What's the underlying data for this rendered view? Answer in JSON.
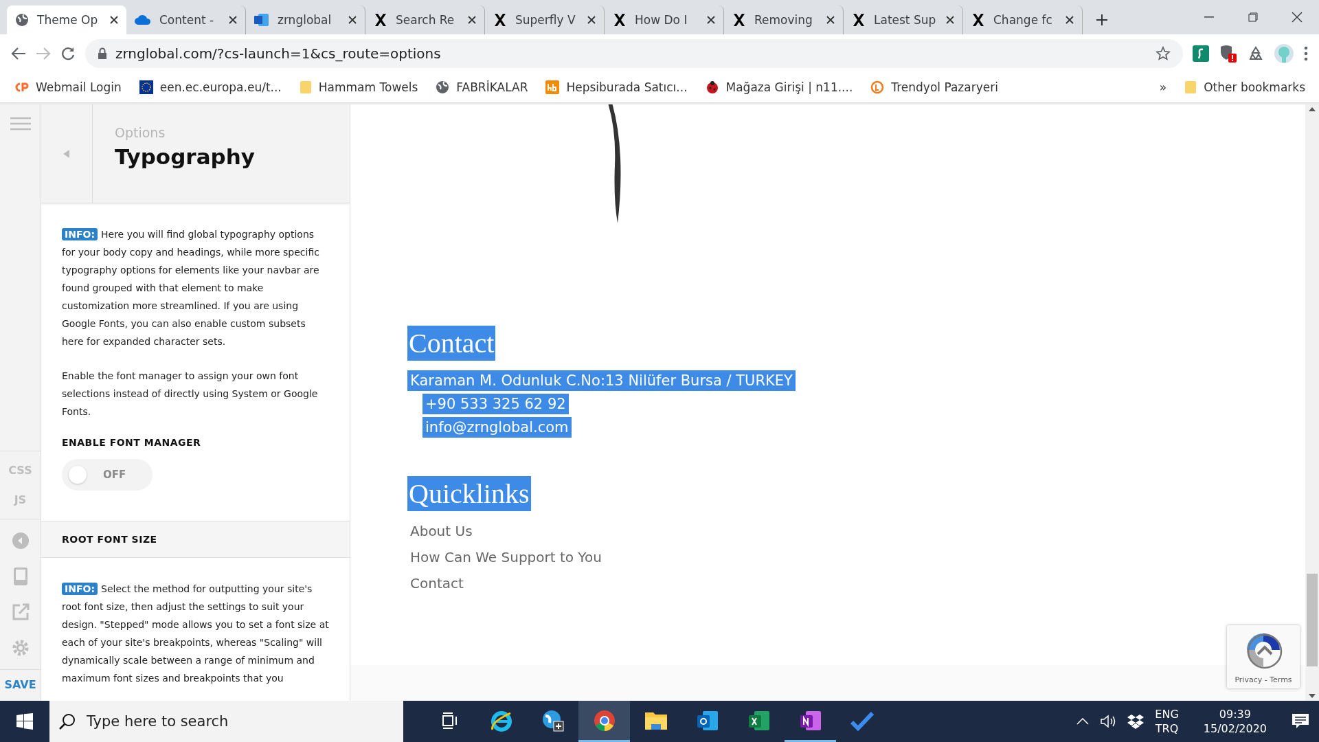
{
  "browser": {
    "tabs": [
      {
        "kind": "globe",
        "title": "Theme Op",
        "selected": true
      },
      {
        "kind": "cloud",
        "title": "Content -",
        "selected": false
      },
      {
        "kind": "doc",
        "title": "zrnglobal",
        "selected": false
      },
      {
        "kind": "x",
        "title": "Search Re",
        "selected": false
      },
      {
        "kind": "x",
        "title": "Superfly V",
        "selected": false
      },
      {
        "kind": "x",
        "title": "How Do I",
        "selected": false
      },
      {
        "kind": "x",
        "title": "Removing",
        "selected": false
      },
      {
        "kind": "x",
        "title": "Latest Sup",
        "selected": false
      },
      {
        "kind": "x",
        "title": "Change fc",
        "selected": false
      }
    ],
    "address": "zrnglobal.com/?cs-launch=1&cs_route=options",
    "bookmarks": [
      {
        "kind": "cp",
        "label": "Webmail Login"
      },
      {
        "kind": "eu",
        "label": "een.ec.europa.eu/t..."
      },
      {
        "kind": "folder",
        "label": "Hammam Towels"
      },
      {
        "kind": "globe",
        "label": "FABRİKALAR"
      },
      {
        "kind": "hb",
        "label": "Hepsiburada Satıcı..."
      },
      {
        "kind": "ladybug",
        "label": "Mağaza Girişi | n11...."
      },
      {
        "kind": "ring",
        "label": "Trendyol Pazaryeri"
      }
    ],
    "more": "»",
    "other_bookmarks": "Other bookmarks"
  },
  "rail": {
    "code_items": [
      "CSS",
      "JS"
    ],
    "save": "SAVE"
  },
  "panel": {
    "subtitle": "Options",
    "title": "Typography",
    "sections": [
      {
        "blocks": [
          {
            "kind": "info",
            "badge": "INFO:",
            "text": "Here you will find global typography options for your body copy and headings, while more specific typography options for elements like your navbar are found grouped with that element to make customization more streamlined. If you are using Google Fonts, you can also enable custom subsets here for expanded character sets."
          },
          {
            "kind": "text",
            "text": "Enable the font manager to assign your own font selections instead of directly using System or Google Fonts."
          },
          {
            "kind": "toggle",
            "label": "ENABLE FONT MANAGER",
            "on": false,
            "state": "OFF"
          }
        ]
      },
      {
        "heading": "ROOT FONT SIZE",
        "blocks": [
          {
            "kind": "info",
            "badge": "INFO:",
            "text": "Select the method for outputting your site's root font size, then adjust the settings to suit your design. \"Stepped\" mode allows you to set a font size at each of your site's breakpoints, whereas \"Scaling\" will dynamically scale between a range of minimum and maximum font sizes and breakpoints that you"
          }
        ]
      }
    ]
  },
  "preview": {
    "blocks": [
      {
        "kind": "heading",
        "text": "Contact",
        "selected": true
      },
      {
        "kind": "address",
        "text": "Karaman M. Odunluk C.No:13 Nilüfer Bursa / TURKEY",
        "selected": true
      },
      {
        "kind": "phone",
        "text": "+90 533 325 62 92",
        "selected": true
      },
      {
        "kind": "email",
        "text": "info@zrnglobal.com",
        "selected": true
      },
      {
        "kind": "heading",
        "text": "Quicklinks",
        "selected": true
      },
      {
        "kind": "link",
        "text": "About Us",
        "selected": false
      },
      {
        "kind": "link",
        "text": "How Can We Support to You",
        "selected": false
      },
      {
        "kind": "link",
        "text": "Contact",
        "selected": false
      }
    ],
    "recaptcha": "Privacy - Terms"
  },
  "taskbar": {
    "search_placeholder": "Type here to search",
    "apps": [
      {
        "kind": "taskview",
        "active": false,
        "running": false
      },
      {
        "kind": "ie",
        "active": false,
        "running": false
      },
      {
        "kind": "globeplus",
        "active": false,
        "running": false
      },
      {
        "kind": "chrome",
        "active": true,
        "running": true
      },
      {
        "kind": "folder",
        "active": false,
        "running": false
      },
      {
        "kind": "mail",
        "active": false,
        "running": false
      },
      {
        "kind": "sheet",
        "active": false,
        "running": false
      },
      {
        "kind": "note",
        "active": false,
        "running": true
      },
      {
        "kind": "check",
        "active": false,
        "running": false
      }
    ],
    "lang": "ENG",
    "layout": "TRQ",
    "time": "09:39",
    "date": "15/02/2020"
  }
}
